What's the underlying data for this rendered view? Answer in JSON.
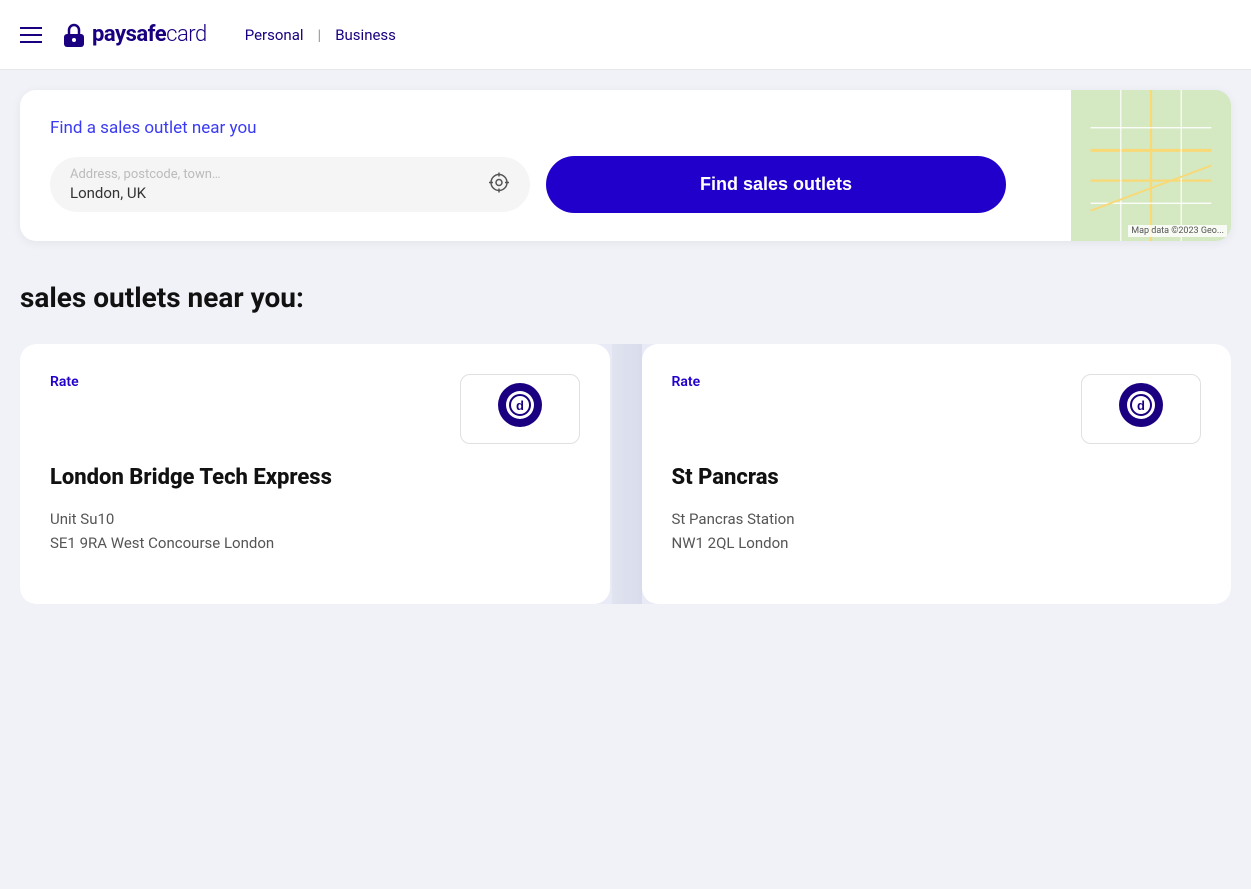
{
  "header": {
    "menu_icon": "hamburger-menu",
    "logo_brand": "paysafe",
    "logo_product": "card",
    "nav": {
      "personal": "Personal",
      "separator": "|",
      "business": "Business"
    }
  },
  "search_section": {
    "title": "Find a sales outlet near you",
    "input": {
      "placeholder": "Address, postcode, town…",
      "value": "London, UK"
    },
    "location_icon": "⊕",
    "button_label": "Find sales outlets",
    "map_credit": "Map data ©2023 Geo..."
  },
  "results": {
    "title": "sales outlets near you:",
    "outlets": [
      {
        "rate_label": "Rate",
        "name": "London Bridge Tech Express",
        "address_line1": "Unit Su10",
        "address_line2": "SE1 9RA West Concourse London"
      },
      {
        "rate_label": "Rate",
        "name": "St Pancras",
        "address_line1": "St Pancras Station",
        "address_line2": "NW1 2QL London"
      }
    ]
  }
}
